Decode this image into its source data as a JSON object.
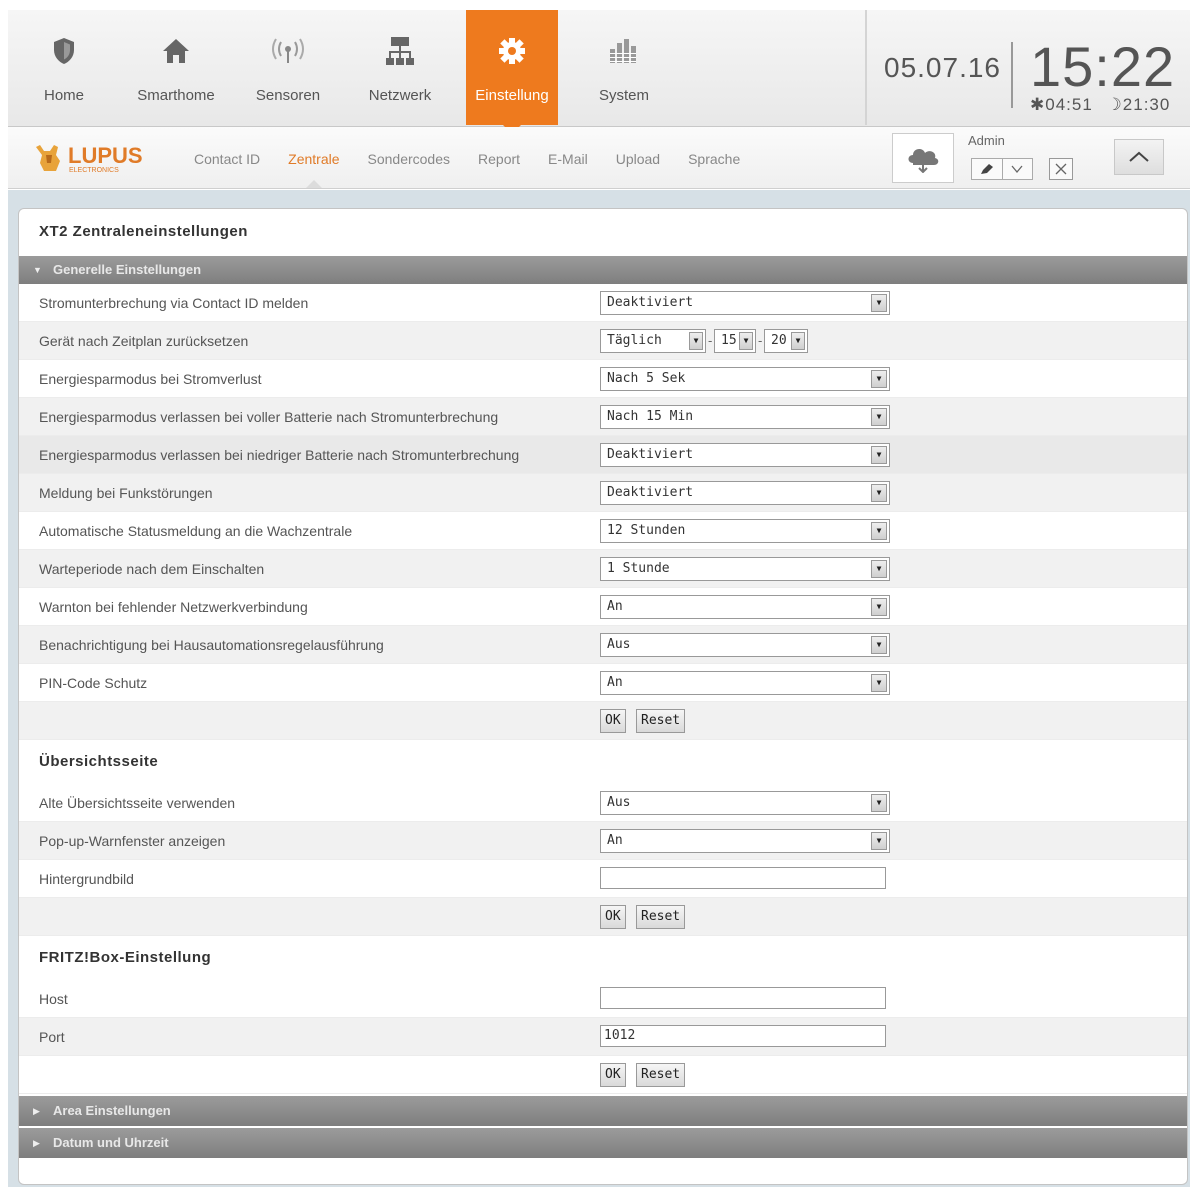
{
  "nav": {
    "items": [
      {
        "label": "Home",
        "icon": "shield-icon"
      },
      {
        "label": "Smarthome",
        "icon": "house-icon"
      },
      {
        "label": "Sensoren",
        "icon": "signal-icon"
      },
      {
        "label": "Netzwerk",
        "icon": "network-icon"
      },
      {
        "label": "Einstellung",
        "icon": "gear-icon",
        "active": true
      },
      {
        "label": "System",
        "icon": "bars-icon"
      }
    ],
    "active_color": "#ee7a1e"
  },
  "clock": {
    "date": "05.07.16",
    "time": "15:22",
    "sunrise": "04:51",
    "sunset": "21:30"
  },
  "subnav": {
    "logo_text": "LUPUS",
    "logo_subtext": "ELECTRONICS",
    "tabs": [
      "Contact ID",
      "Zentrale",
      "Sondercodes",
      "Report",
      "E-Mail",
      "Upload",
      "Sprache"
    ],
    "active_tab": "Zentrale",
    "user_label": "Admin"
  },
  "page": {
    "title": "XT2 Zentraleneinstellungen",
    "section_general": "Generelle Einstellungen",
    "general_rows": [
      {
        "label": "Stromunterbrechung via Contact ID melden",
        "value": "Deaktiviert"
      },
      {
        "label": "Gerät nach Zeitplan zurücksetzen",
        "value": "Täglich",
        "hour": "15",
        "minute": "20"
      },
      {
        "label": "Energiesparmodus bei Stromverlust",
        "value": "Nach 5 Sek"
      },
      {
        "label": "Energiesparmodus verlassen bei voller Batterie nach Stromunterbrechung",
        "value": "Nach 15 Min"
      },
      {
        "label": "Energiesparmodus verlassen bei niedriger Batterie nach Stromunterbrechung",
        "value": "Deaktiviert"
      },
      {
        "label": "Meldung bei Funkstörungen",
        "value": "Deaktiviert"
      },
      {
        "label": "Automatische Statusmeldung an die Wachzentrale",
        "value": "12 Stunden"
      },
      {
        "label": "Warteperiode nach dem Einschalten",
        "value": "1 Stunde"
      },
      {
        "label": "Warnton bei fehlender Netzwerkverbindung",
        "value": "An"
      },
      {
        "label": "Benachrichtigung bei Hausautomationsregelausführung",
        "value": "Aus"
      },
      {
        "label": "PIN-Code Schutz",
        "value": "An"
      }
    ],
    "ok_label": "OK",
    "reset_label": "Reset",
    "overview_title": "Übersichtsseite",
    "overview_rows": [
      {
        "label": "Alte Übersichtsseite verwenden",
        "value": "Aus"
      },
      {
        "label": "Pop-up-Warnfenster anzeigen",
        "value": "An"
      },
      {
        "label": "Hintergrundbild",
        "value": ""
      }
    ],
    "fritz_title": "FRITZ!Box-Einstellung",
    "fritz_rows": [
      {
        "label": "Host",
        "value": ""
      },
      {
        "label": "Port",
        "value": "1012"
      }
    ],
    "section_area": "Area Einstellungen",
    "section_datetime": "Datum und Uhrzeit"
  }
}
